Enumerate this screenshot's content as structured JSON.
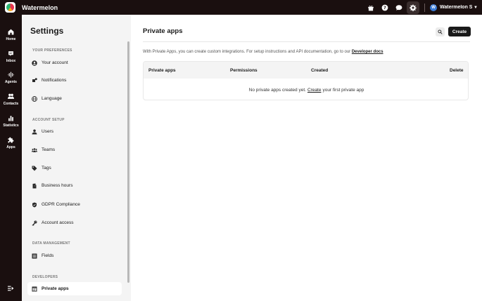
{
  "app": {
    "title": "Watermelon"
  },
  "topbar": {
    "account_avatar": "W",
    "account_name": "Watermelon Support"
  },
  "leftnav": {
    "items": [
      {
        "label": "Home",
        "icon": "home-icon"
      },
      {
        "label": "Inbox",
        "icon": "inbox-icon"
      },
      {
        "label": "Agents",
        "icon": "agents-icon"
      },
      {
        "label": "Contacts",
        "icon": "contacts-icon"
      },
      {
        "label": "Statistics",
        "icon": "statistics-icon"
      },
      {
        "label": "Apps",
        "icon": "apps-icon"
      }
    ]
  },
  "settings": {
    "title": "Settings",
    "sections": {
      "preferences": "YOUR PREFERENCES",
      "account_setup": "ACCOUNT SETUP",
      "data_management": "DATA MANAGEMENT",
      "developers": "DEVELOPERS"
    },
    "items": {
      "your_account": "Your account",
      "notifications": "Notifications",
      "language": "Language",
      "users": "Users",
      "teams": "Teams",
      "tags": "Tags",
      "business_hours": "Business hours",
      "gdpr": "GDPR Compliance",
      "account_access": "Account access",
      "fields": "Fields",
      "private_apps": "Private apps"
    }
  },
  "main": {
    "title": "Private apps",
    "create_label": "Create",
    "description": "With Private Apps, you can create custom integrations. For setup instructions and API documentation, go to our",
    "developer_docs_link": "Developer docs",
    "table": {
      "columns": [
        "Private apps",
        "Permissions",
        "Created",
        "Delete"
      ],
      "empty_prefix": "No private apps created yet.",
      "empty_link": "Create",
      "empty_suffix": "your first private app"
    }
  }
}
